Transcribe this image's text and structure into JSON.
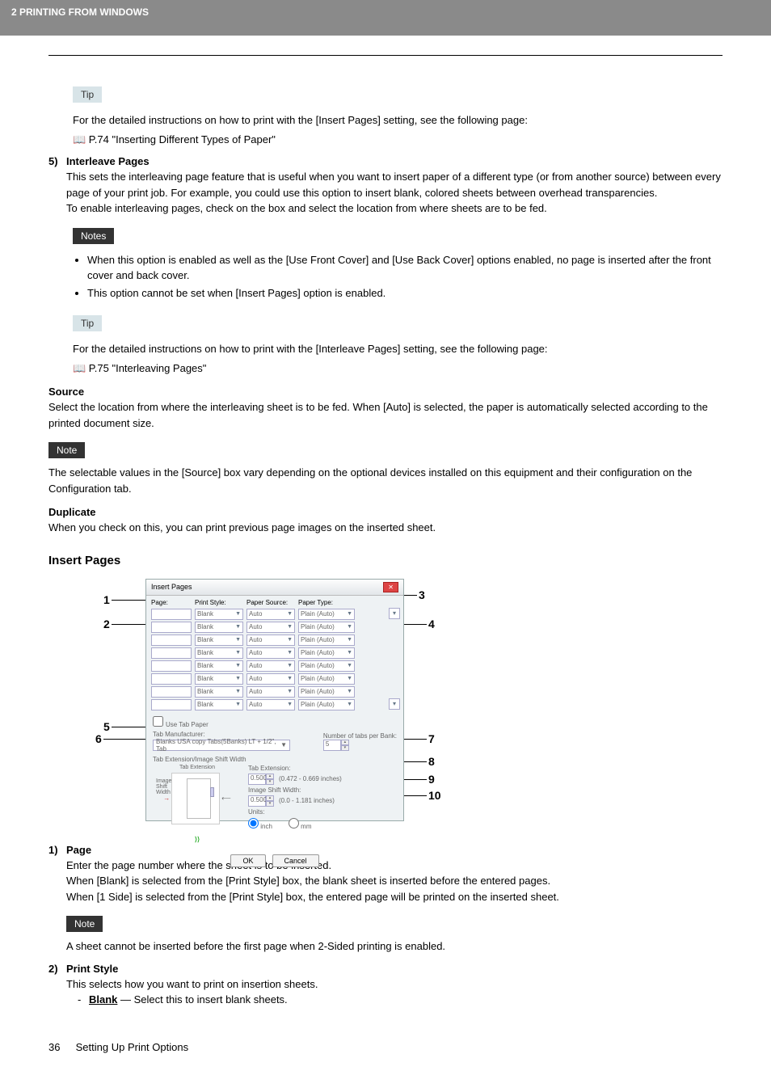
{
  "header": {
    "title": "2 PRINTING FROM WINDOWS"
  },
  "tip1": {
    "badge": "Tip",
    "line1": "For the detailed instructions on how to print with the [Insert Pages] setting, see the following page:",
    "line2": "📖 P.74 \"Inserting Different Types of Paper\""
  },
  "item5": {
    "num": "5)",
    "title": "Interleave Pages",
    "p1": "This sets the interleaving page feature that is useful when you want to insert paper of a different type (or from another source) between every page of your print job. For example, you could use this option to insert blank, colored sheets between overhead transparencies.",
    "p2": "To enable interleaving pages, check on the box and select the location from where sheets are to be fed."
  },
  "notes": {
    "badge": "Notes",
    "bullets": [
      "When this option is enabled as well as the [Use Front Cover] and [Use Back Cover] options enabled, no page is inserted after the front cover and back cover.",
      "This option cannot be set when [Insert Pages] option is enabled."
    ]
  },
  "tip2": {
    "badge": "Tip",
    "line1": "For the detailed instructions on how to print with the [Interleave Pages] setting, see the following page:",
    "line2": "📖 P.75 \"Interleaving Pages\""
  },
  "source": {
    "head": "Source",
    "p": "Select the location from where the interleaving sheet is to be fed.  When [Auto] is selected, the paper is automatically selected according to the printed document size."
  },
  "note1": {
    "badge": "Note",
    "p": "The selectable values in the [Source] box vary depending on the optional devices installed on this equipment and their configuration on the Configuration tab."
  },
  "duplicate": {
    "head": "Duplicate",
    "p": "When you check on this, you can print previous page images on the inserted sheet."
  },
  "insert": {
    "head": "Insert Pages"
  },
  "dialog": {
    "title": "Insert Pages",
    "cols": {
      "page": "Page:",
      "print_style": "Print Style:",
      "paper_source": "Paper Source:",
      "paper_type": "Paper Type:"
    },
    "row_values": {
      "blank": "Blank",
      "auto": "Auto",
      "plain_auto": "Plain (Auto)"
    },
    "use_tab": "Use Tab Paper",
    "tab_mfr": "Tab Manufacturer:",
    "tab_mfr_val": "Blanks USA copy Tabs(5Banks) LT + 1/2\", Tab",
    "num_tabs": "Number of tabs per Bank:",
    "num_tabs_val": "5",
    "tab_ext_head": "Tab Extension/Image Shift Width",
    "dia_tab_ext": "Tab Extension",
    "dia_img_shift": "Image Shift Width",
    "tab_ext": "Tab Extension:",
    "tab_ext_val": "0.500",
    "tab_ext_range": "(0.472 - 0.669 inches)",
    "img_shift": "Image Shift Width:",
    "img_shift_val": "0.500",
    "img_shift_range": "(0.0 - 1.181 inches)",
    "units": "Units:",
    "inch": "inch",
    "mm": "mm",
    "ok": "OK",
    "cancel": "Cancel"
  },
  "callouts": {
    "c1": "1",
    "c2": "2",
    "c3": "3",
    "c4": "4",
    "c5": "5",
    "c6": "6",
    "c7": "7",
    "c8": "8",
    "c9": "9",
    "c10": "10"
  },
  "item1": {
    "num": "1)",
    "title": "Page",
    "p1": "Enter the page number where the sheet is to be inserted.",
    "p2": "When [Blank] is selected from the [Print Style] box, the blank sheet is inserted before the entered pages.",
    "p3": "When [1 Side] is selected from the [Print Style] box, the entered page will be printed on the inserted sheet."
  },
  "note2": {
    "badge": "Note",
    "p": "A sheet cannot be inserted before the first page when 2-Sided printing is enabled."
  },
  "item2": {
    "num": "2)",
    "title": "Print Style",
    "p1": "This selects how you want to print on insertion sheets.",
    "dash_label": "Blank",
    "dash_rest": " — Select this to insert blank sheets."
  },
  "footer": {
    "page": "36",
    "section": "Setting Up Print Options"
  }
}
